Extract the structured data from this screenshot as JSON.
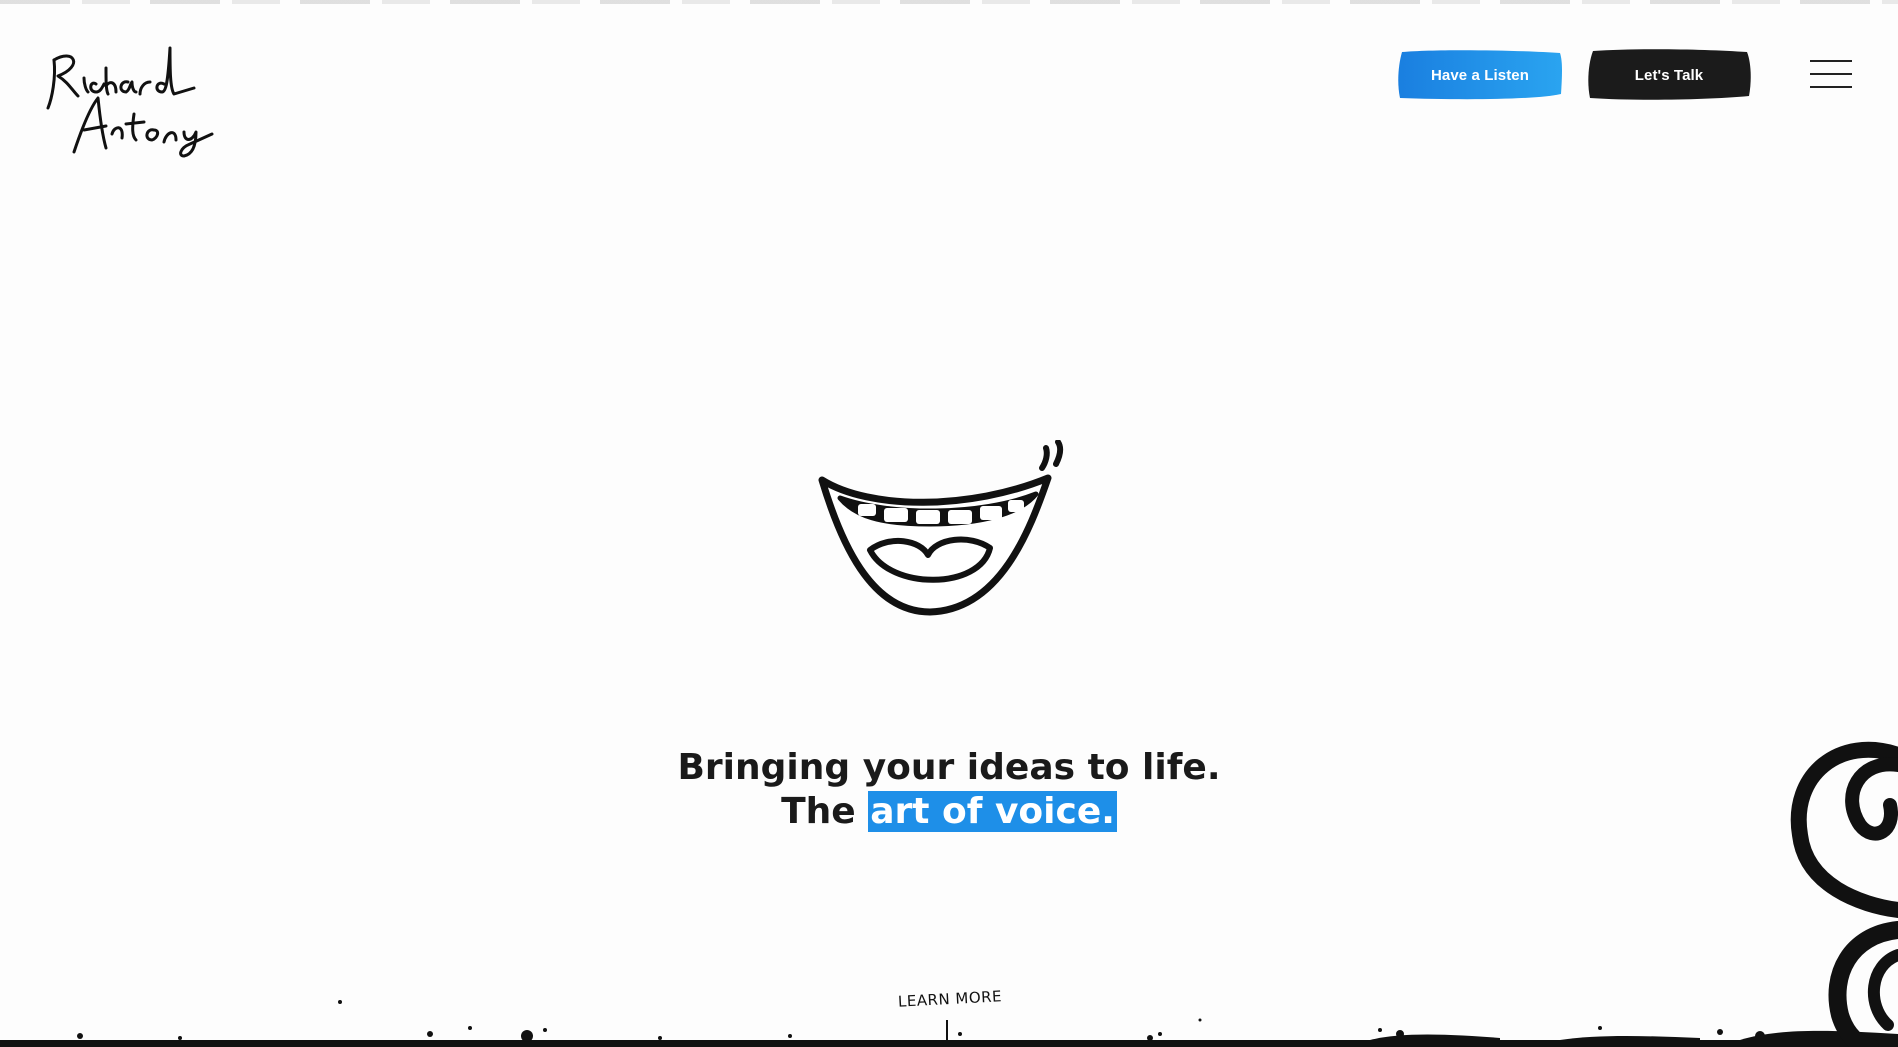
{
  "header": {
    "logo_text": "Richard Antony",
    "buttons": {
      "listen_label": "Have a Listen",
      "talk_label": "Let's Talk"
    },
    "menu_icon": "hamburger-icon"
  },
  "hero": {
    "illustration": "smiling-mouth-icon",
    "headline_line1": "Bringing your ideas to life.",
    "headline_line2_prefix": "The",
    "headline_line2_highlight": "art of voice.",
    "learn_more_label": "LEARN MORE"
  },
  "colors": {
    "accent_blue": "#1e8fe8",
    "dark": "#1a1a1a",
    "background": "#fdfdfd"
  }
}
